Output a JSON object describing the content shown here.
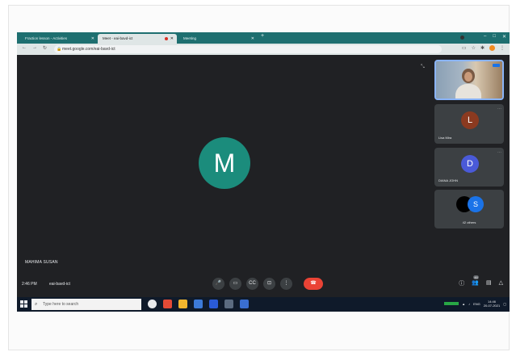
{
  "browser": {
    "tabs": [
      {
        "label": "Fraction lesson - Activities",
        "active": false
      },
      {
        "label": "Meet - eai-bavd-ict",
        "active": true,
        "recording": true
      },
      {
        "label": "Meeting",
        "active": false
      }
    ],
    "new_tab": "+",
    "window_controls": [
      "–",
      "□",
      "✕"
    ],
    "url": "meet.google.com/eai-bavd-ict"
  },
  "meet": {
    "main_avatar_letter": "M",
    "speaker_name": "MAHIMA SUSAN",
    "participants": [
      {
        "kind": "video",
        "name": ""
      },
      {
        "kind": "avatar",
        "letter": "L",
        "name": "Lisa Mira",
        "color": "#8b3a20"
      },
      {
        "kind": "avatar",
        "letter": "D",
        "name": "DIANA JOHN",
        "color": "#4a5ad8"
      },
      {
        "kind": "group",
        "letter": "S",
        "name": "42 others"
      }
    ],
    "time": "2:46 PM",
    "meeting_code": "eai-bavd-ict",
    "controls": {
      "mic": "🎤",
      "camera": "▭",
      "captions": "CC",
      "present": "⊡",
      "more": "⋮",
      "end_call": "☎"
    },
    "right_controls": {
      "info": "ⓘ",
      "people": "👥",
      "people_count": "46",
      "chat": "▤",
      "activities": "△"
    },
    "accent_colors": {
      "avatar_main": "#1b8c7c",
      "end_call": "#ea4335",
      "present_blue": "#1a73e8"
    }
  },
  "taskbar": {
    "search_placeholder": "Type here to search",
    "clock_time": "14:46",
    "clock_date": "20-07-2021",
    "lang": "ENG"
  }
}
